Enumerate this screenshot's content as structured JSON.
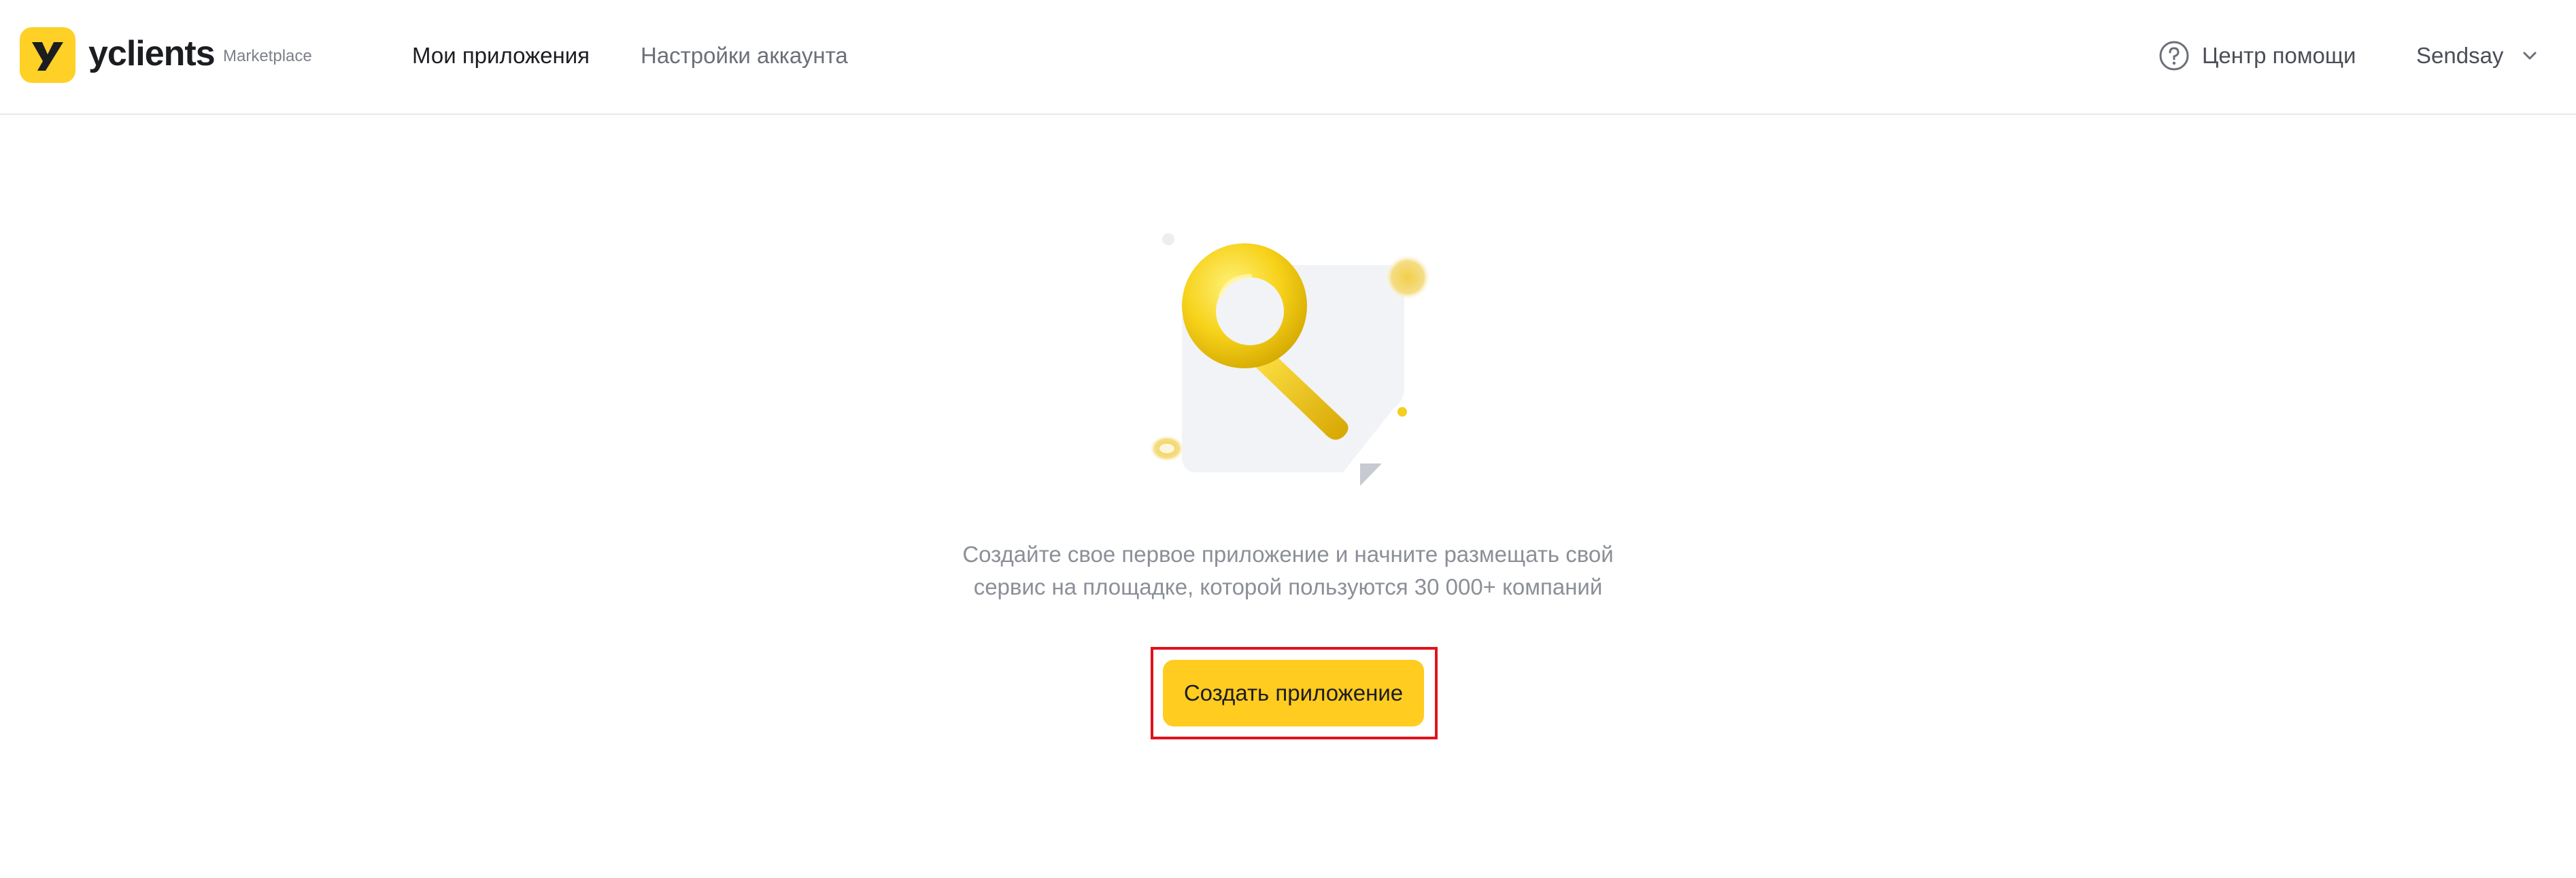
{
  "header": {
    "brand": "yclients",
    "brand_sub": "Marketplace",
    "nav": {
      "my_apps": "Мои приложения",
      "account_settings": "Настройки аккаунта"
    },
    "help_label": "Центр помощи",
    "user_name": "Sendsay"
  },
  "main": {
    "empty_line1": "Создайте свое первое приложение и начните размещать свой",
    "empty_line2": "сервис на площадке, которой пользуются 30 000+ компаний",
    "create_button_label": "Создать приложение"
  },
  "icons": {
    "logo": "yclients-logo-icon",
    "help": "question-circle-icon",
    "dropdown": "chevron-down-icon",
    "illustration": "magnifier-illustration"
  },
  "colors": {
    "accent": "#ffcc1f",
    "highlight_border": "#e1121b",
    "muted_text": "#8b8f97"
  }
}
